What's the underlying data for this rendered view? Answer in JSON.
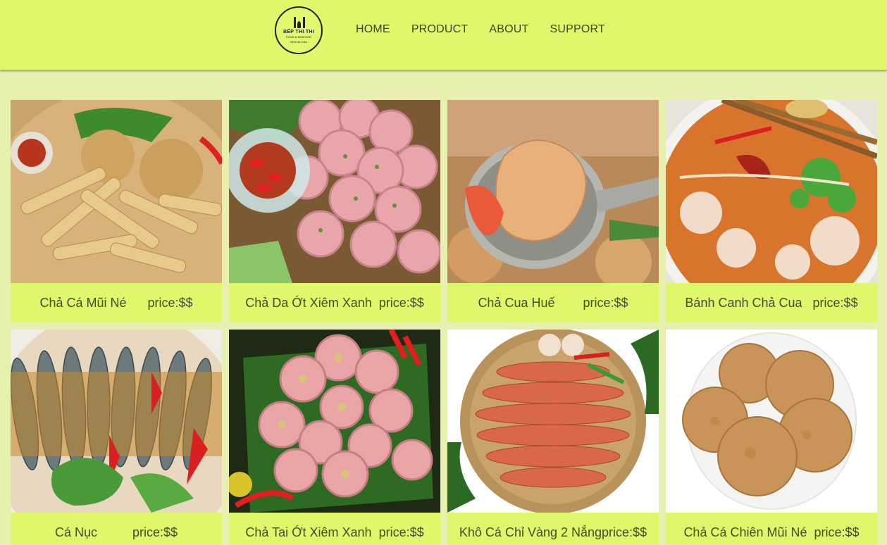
{
  "header": {
    "logo": {
      "name": "BẾP THI THI",
      "tagline": "FOOD & SEAFOOD",
      "phone": "0909 301 051"
    },
    "nav": [
      "HOME",
      "PRODUCT",
      "ABOUT",
      "SUPPORT"
    ]
  },
  "products": [
    {
      "label": "Chả Cá Mũi Né      price:$$",
      "image": "fish-cake-basket"
    },
    {
      "label": "Chả Da Ớt Xiêm Xanh  price:$$",
      "image": "pork-roll-slices"
    },
    {
      "label": "Chả Cua Huế        price:$$",
      "image": "crab-cake-ladle"
    },
    {
      "label": "Bánh Canh Chả Cua   price:$$",
      "image": "noodle-soup-bowl"
    },
    {
      "label": "Cá Nục          price:$$",
      "image": "braised-mackerel"
    },
    {
      "label": "Chả Tai Ớt Xiêm Xanh  price:$$",
      "image": "pork-ear-roll"
    },
    {
      "label": "Khô Cá Chỉ Vàng 2 Nắngprice:$$",
      "image": "dried-fish-basket"
    },
    {
      "label": "Chả Cá Chiên Mũi Né  price:$$",
      "image": "fried-fish-cakes-plate"
    }
  ]
}
